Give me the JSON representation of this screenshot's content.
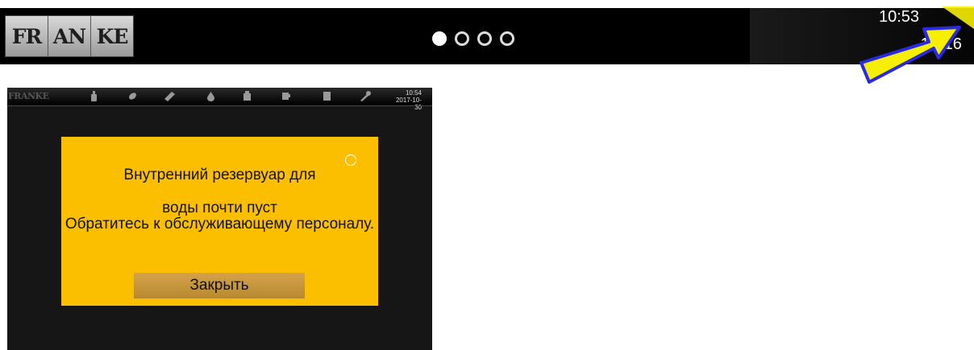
{
  "header": {
    "logo_letters": [
      "FR",
      "AN",
      "KE"
    ],
    "page_dots": [
      "active",
      "inactive",
      "inactive",
      "inactive"
    ],
    "time": "10:53",
    "date_partial": "-10-16",
    "annotation_arrow_color": "#f6ef00"
  },
  "device": {
    "logo": "FRANKE",
    "toolbar_icons": [
      "bottle-icon",
      "coffee-bean-icon",
      "cleaning-icon",
      "water-drop-icon",
      "milk-icon",
      "cup-icon",
      "document-icon",
      "wrench-icon"
    ],
    "time": "10:54",
    "date": "2017-10-30"
  },
  "dialog": {
    "message_line1": "Внутренний резервуар для",
    "message_line2": "воды почти пуст",
    "message_line3": "Обратитесь к обслуживающему персоналу.",
    "close_label": "Закрыть",
    "background_color": "#fbbf00"
  }
}
